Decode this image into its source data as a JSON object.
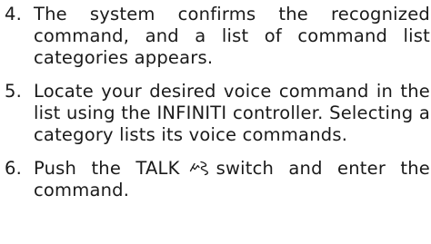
{
  "steps": [
    {
      "number": "4.",
      "text": "The system confirms the recognized command, and a list of command list categories appears."
    },
    {
      "number": "5.",
      "text": "Locate your desired voice command in the list using the INFINITI controller. Selecting a category lists its voice commands."
    },
    {
      "number": "6.",
      "text_before_icon": "Push the TALK",
      "icon": "talk-switch-icon",
      "text_after_icon": "switch and enter the command."
    }
  ]
}
